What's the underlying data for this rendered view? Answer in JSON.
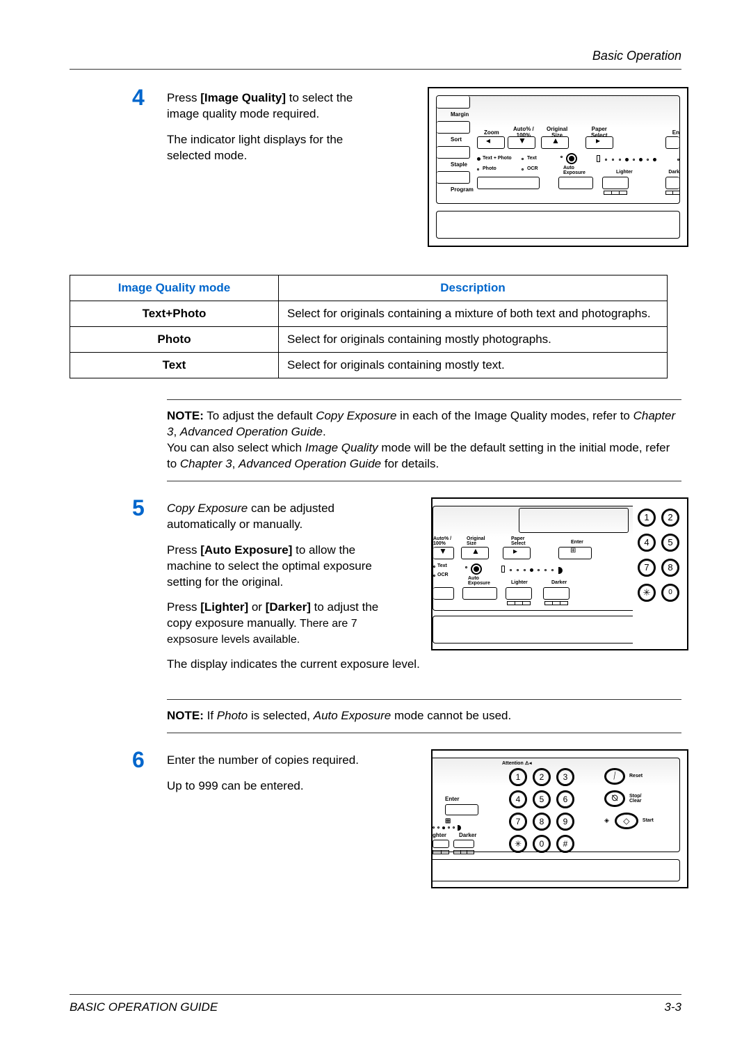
{
  "header": "Basic Operation",
  "footer": {
    "left": "BASIC OPERATION GUIDE",
    "right": "3-3"
  },
  "step4": {
    "number": "4",
    "p1a": "Press ",
    "p1b": "[Image Quality] ",
    "p1c": "to select the image quality mode required.",
    "p2": "The indicator light displays for the selected mode."
  },
  "table": {
    "h1": "Image Quality mode",
    "h2": "Description",
    "r1c1": "Text+Photo",
    "r1c2": "Select for originals containing a mixture of both text and photographs.",
    "r2c1": "Photo",
    "r2c2": "Select for originals containing mostly photographs.",
    "r3c1": "Text",
    "r3c2": "Select for originals containing mostly text."
  },
  "note1": {
    "label": "NOTE:",
    "t1": " To adjust the default ",
    "t2": "Copy Exposure",
    "t3": " in each of the Image Quality modes, refer to ",
    "t4": "Chapter 3",
    "t5": ", ",
    "t6": "Advanced Operation Guide",
    "t7": ".",
    "t8": "You can also select which ",
    "t9": "Image Quality",
    "t10": " mode will be the default setting in the initial mode, refer to ",
    "t11": "Chapter 3",
    "t12": ", ",
    "t13": "Advanced Operation Guide",
    "t14": " for details."
  },
  "step5": {
    "number": "5",
    "p1a": "Copy Exposure",
    "p1b": " can be adjusted automatically or manually.",
    "p2a": "Press ",
    "p2b": "[Auto Exposure]",
    "p2c": " to allow the machine to select the optimal exposure setting for the original.",
    "p3a": "Press ",
    "p3b": "[Lighter]",
    "p3c": " or ",
    "p3d": "[Darker]",
    "p3e": " to adjust the copy exposure manually.",
    "p3f": "  There are 7 expsosure levels available.",
    "p4": "The display indicates the current exposure level."
  },
  "note2": {
    "label": "NOTE:",
    "t1": " If ",
    "t2": "Photo",
    "t3": " is selected, ",
    "t4": "Auto Exposure",
    "t5": " mode cannot be used."
  },
  "step6": {
    "number": "6",
    "p1": "Enter the number of copies required.",
    "p2": "Up to 999 can be entered."
  },
  "panel": {
    "margin": "Margin",
    "sort": "Sort",
    "staple": "Staple",
    "program": "Program",
    "zoom": "Zoom",
    "auto100": "Auto% /\n100%",
    "original_size": "Original\nSize",
    "paper_select": "Paper\nSelect",
    "enter": "En",
    "text_photo": "Text + Photo",
    "text": "Text",
    "photo": "Photo",
    "ocr": "OCR",
    "auto_exposure": "Auto\nExposure",
    "lighter": "Lighter",
    "darker": "Dark",
    "enter_full": "Enter",
    "lighter_full": "Lighter",
    "darker_full": "Darker",
    "lighter_cut": "ghter",
    "keys": {
      "k1": "1",
      "k2": "2",
      "k3": "3",
      "k4": "4",
      "k5": "5",
      "k6": "6",
      "k7": "7",
      "k8": "8",
      "k9": "9",
      "k0": "0"
    }
  },
  "keypad6": {
    "attention": "Attention",
    "reset": "Reset",
    "stop_clear": "Stop/\nClear",
    "start": "Start",
    "enter": "Enter",
    "lighter": "ghter",
    "darker": "Darker"
  }
}
